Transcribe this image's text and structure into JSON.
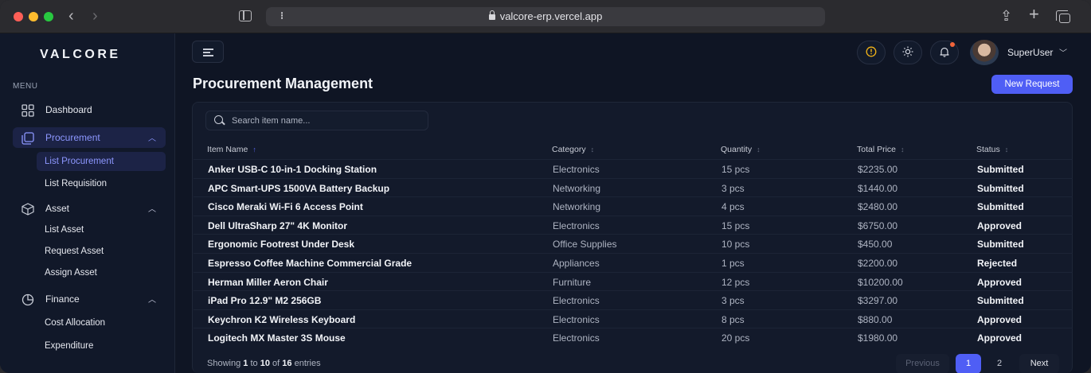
{
  "browser": {
    "url": "valcore-erp.vercel.app",
    "extra_glyph": "⁝"
  },
  "sidebar": {
    "brand": "VALCORE",
    "menu_label": "MENU",
    "items": [
      {
        "label": "Dashboard",
        "icon": "grid-icon"
      },
      {
        "label": "Procurement",
        "icon": "layers-icon",
        "expanded": true,
        "active": true,
        "children": [
          {
            "label": "List Procurement",
            "active": true
          },
          {
            "label": "List Requisition"
          }
        ]
      },
      {
        "label": "Asset",
        "icon": "cube-icon",
        "expanded": true,
        "children": [
          {
            "label": "List Asset"
          },
          {
            "label": "Request Asset"
          },
          {
            "label": "Assign Asset"
          }
        ]
      },
      {
        "label": "Finance",
        "icon": "pie-icon",
        "expanded": true,
        "children": [
          {
            "label": "Cost Allocation"
          },
          {
            "label": "Expenditure"
          }
        ]
      }
    ]
  },
  "topbar": {
    "username": "SuperUser",
    "icons": [
      "info-icon",
      "sun-icon",
      "bell-icon"
    ],
    "notification_dot_color": "#f2643a"
  },
  "page": {
    "title": "Procurement Management",
    "new_button": "New Request",
    "search_placeholder": "Search item name..."
  },
  "table": {
    "headers": [
      "Item Name",
      "Category",
      "Quantity",
      "Total Price",
      "Status"
    ],
    "sorted_column": "Item Name",
    "rows": [
      [
        "Anker USB-C 10-in-1 Docking Station",
        "Electronics",
        "15 pcs",
        "$2235.00",
        "Submitted"
      ],
      [
        "APC Smart-UPS 1500VA Battery Backup",
        "Networking",
        "3 pcs",
        "$1440.00",
        "Submitted"
      ],
      [
        "Cisco Meraki Wi-Fi 6 Access Point",
        "Networking",
        "4 pcs",
        "$2480.00",
        "Submitted"
      ],
      [
        "Dell UltraSharp 27\" 4K Monitor",
        "Electronics",
        "15 pcs",
        "$6750.00",
        "Approved"
      ],
      [
        "Ergonomic Footrest Under Desk",
        "Office Supplies",
        "10 pcs",
        "$450.00",
        "Submitted"
      ],
      [
        "Espresso Coffee Machine Commercial Grade",
        "Appliances",
        "1 pcs",
        "$2200.00",
        "Rejected"
      ],
      [
        "Herman Miller Aeron Chair",
        "Furniture",
        "12 pcs",
        "$10200.00",
        "Approved"
      ],
      [
        "iPad Pro 12.9\" M2 256GB",
        "Electronics",
        "3 pcs",
        "$3297.00",
        "Submitted"
      ],
      [
        "Keychron K2 Wireless Keyboard",
        "Electronics",
        "8 pcs",
        "$880.00",
        "Approved"
      ],
      [
        "Logitech MX Master 3S Mouse",
        "Electronics",
        "20 pcs",
        "$1980.00",
        "Approved"
      ]
    ]
  },
  "footer": {
    "showing_prefix": "Showing",
    "from": "1",
    "to_word": "to",
    "to": "10",
    "of_word": "of",
    "total": "16",
    "suffix": "entries",
    "pagination": {
      "previous": "Previous",
      "pages": [
        "1",
        "2"
      ],
      "current": "1",
      "next": "Next"
    }
  },
  "colors": {
    "accent": "#4f5ef5",
    "active_text": "#8d97ff",
    "background": "#0f1524"
  }
}
